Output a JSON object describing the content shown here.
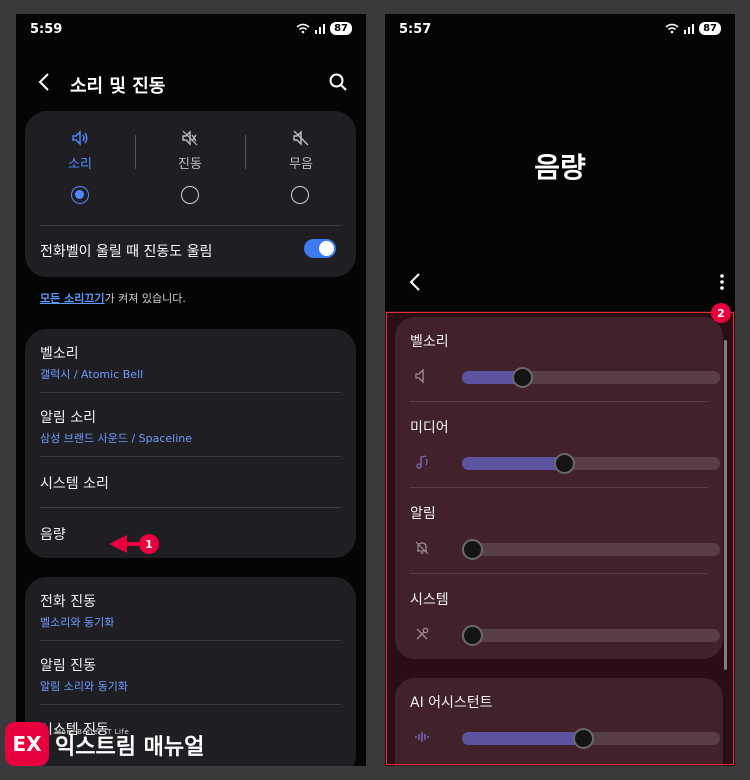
{
  "left": {
    "status": {
      "time": "5:59",
      "battery": "87"
    },
    "title": "소리 및 진동",
    "modes": [
      {
        "label": "소리",
        "selected": true
      },
      {
        "label": "진동",
        "selected": false
      },
      {
        "label": "무음",
        "selected": false
      }
    ],
    "vibrate_on_ring": {
      "label": "전화벨이 울릴 때 진동도 울림",
      "on": true
    },
    "notice": {
      "link": "모든 소리끄기",
      "rest": "가 켜져 있습니다."
    },
    "sound_items": [
      {
        "title": "벨소리",
        "sub": "갤럭시 / Atomic Bell"
      },
      {
        "title": "알림 소리",
        "sub": "삼성 브랜드 사운드 / Spaceline"
      },
      {
        "title": "시스템 소리",
        "sub": ""
      },
      {
        "title": "음량",
        "sub": ""
      }
    ],
    "vib_items": [
      {
        "title": "전화 진동",
        "sub": "벨소리와 동기화"
      },
      {
        "title": "알림 진동",
        "sub": "알림 소리와 동기화"
      },
      {
        "title": "시스템 진동",
        "sub": ""
      }
    ],
    "marker": "1"
  },
  "right": {
    "status": {
      "time": "5:57",
      "battery": "87"
    },
    "title": "음량",
    "volumes": [
      {
        "label": "벨소리",
        "icon": "speaker-icon",
        "level": 0.21
      },
      {
        "label": "미디어",
        "icon": "music-note-icon",
        "level": 0.39
      },
      {
        "label": "알림",
        "icon": "bell-muted-icon",
        "level": 0.0
      },
      {
        "label": "시스템",
        "icon": "tools-icon",
        "level": 0.0
      }
    ],
    "ai": {
      "label": "AI 어시스턴트",
      "icon": "waveform-icon",
      "level": 0.47
    },
    "marker": "2"
  },
  "logo": {
    "tagline": "More Better IT Life",
    "name": "익스트림 매뉴얼",
    "mark": "EX"
  },
  "colors": {
    "accent": "#4f8bff",
    "highlight": "#e8003f",
    "slider_fill": "#5a54a0"
  }
}
